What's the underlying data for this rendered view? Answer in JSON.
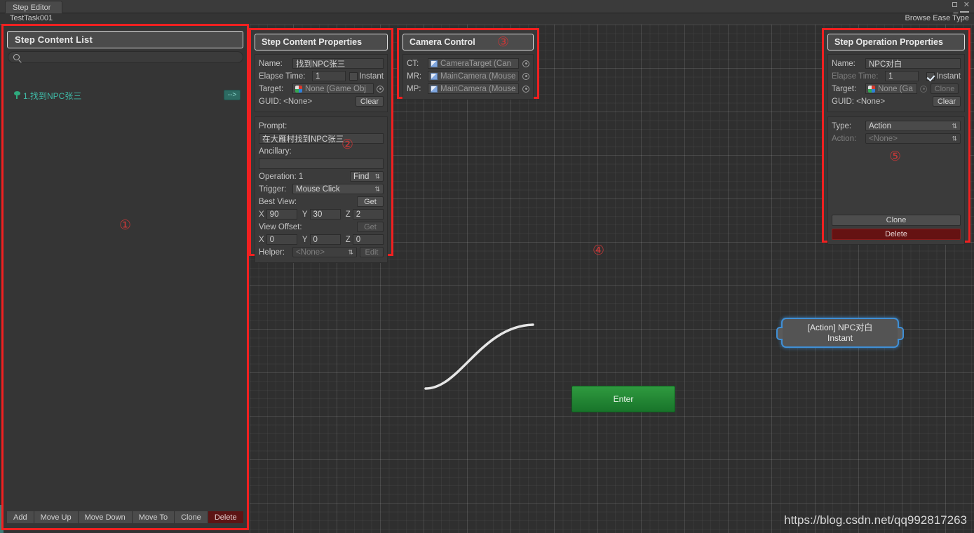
{
  "window": {
    "tab_label": "Step Editor",
    "task_name": "TestTask001",
    "browse_ease_type": "Browse Ease Type",
    "minimize_icon": "square-icon",
    "close_icon": "close-icon",
    "menu_icon": "hamburger-menu-icon"
  },
  "content_list": {
    "title": "Step Content List",
    "search_placeholder": "",
    "search_value": "",
    "search_icon": "search-icon",
    "items": [
      {
        "icon": "leaf-icon",
        "label": "1.找到NPC张三",
        "goto_label": "-->"
      }
    ],
    "toolbar": [
      {
        "label": "Add",
        "danger": false
      },
      {
        "label": "Move Up",
        "danger": false
      },
      {
        "label": "Move Down",
        "danger": false
      },
      {
        "label": "Move To",
        "danger": false
      },
      {
        "label": "Clone",
        "danger": false
      },
      {
        "label": "Delete",
        "danger": true
      }
    ]
  },
  "step_content_properties": {
    "title": "Step Content Properties",
    "name_label": "Name:",
    "name_value": "找到NPC张三",
    "elapse_label": "Elapse Time:",
    "elapse_value": "1",
    "instant_label": "Instant",
    "instant_checked": false,
    "target_label": "Target:",
    "target_value": "None (Game Obj",
    "guid_label": "GUID: <None>",
    "clear_label": "Clear",
    "prompt_label": "Prompt:",
    "prompt_value": "在大雁村找到NPC张三",
    "ancillary_label": "Ancillary:",
    "ancillary_value": "",
    "operation_label": "Operation: 1",
    "find_label": "Find",
    "trigger_label": "Trigger:",
    "trigger_value": "Mouse Click",
    "best_view_label": "Best View:",
    "best_view_get": "Get",
    "best_view_x_label": "X",
    "best_view_x": "90",
    "best_view_y_label": "Y",
    "best_view_y": "30",
    "best_view_z_label": "Z",
    "best_view_z": "2",
    "view_offset_label": "View Offset:",
    "view_offset_get": "Get",
    "view_offset_x_label": "X",
    "view_offset_x": "0",
    "view_offset_y_label": "Y",
    "view_offset_y": "0",
    "view_offset_z_label": "Z",
    "view_offset_z": "0",
    "helper_label": "Helper:",
    "helper_value": "<None>",
    "helper_edit": "Edit"
  },
  "camera_control": {
    "title": "Camera Control",
    "rows": [
      {
        "label": "CT:",
        "value": "CameraTarget (Can",
        "icon": "cube-icon",
        "picker": "object-picker-icon"
      },
      {
        "label": "MR:",
        "value": "MainCamera (Mouse",
        "icon": "cube-icon",
        "picker": "object-picker-icon"
      },
      {
        "label": "MP:",
        "value": "MainCamera (Mouse",
        "icon": "cube-icon",
        "picker": "object-picker-icon"
      }
    ]
  },
  "step_operation_properties": {
    "title": "Step Operation Properties",
    "name_label": "Name:",
    "name_value": "NPC对白",
    "elapse_label": "Elapse Time:",
    "elapse_value": "1",
    "instant_label": "Instant",
    "instant_checked": true,
    "target_label": "Target:",
    "target_value": "None (Ga",
    "clone_small_label": "Clone",
    "guid_label": "GUID: <None>",
    "clear_label": "Clear",
    "type_label": "Type:",
    "type_value": "Action",
    "action_label": "Action:",
    "action_value": "<None>",
    "clone_label": "Clone",
    "delete_label": "Delete"
  },
  "graph": {
    "enter_node_label": "Enter",
    "action_node_title": "[Action] NPC对白",
    "action_node_subtitle": "Instant",
    "watermark": "https://blog.csdn.net/qq992817263"
  },
  "markers": {
    "one": "①",
    "two": "②",
    "three": "③",
    "four": "④",
    "five": "⑤"
  },
  "colors": {
    "highlight_red": "#f02020",
    "marker_red": "#c63838",
    "node_blue": "#3f8fd6",
    "enter_green": "#2f9a3f",
    "list_teal": "#3fb9a6",
    "panel_bg": "#383838",
    "danger_red": "#5c1414"
  }
}
